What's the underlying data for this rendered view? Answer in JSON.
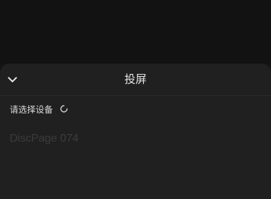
{
  "sheet": {
    "title": "投屏",
    "collapse_icon": "chevron-down-icon"
  },
  "devices": {
    "section_label": "请选择设备",
    "loading_icon": "loading-spinner-icon",
    "items": [
      {
        "name": "DiscPage 074"
      }
    ]
  },
  "colors": {
    "backdrop": "#141414",
    "sheet_bg": "#202020",
    "title_text": "#e6e6e6",
    "device_text_faded": "#3c3c3c"
  }
}
